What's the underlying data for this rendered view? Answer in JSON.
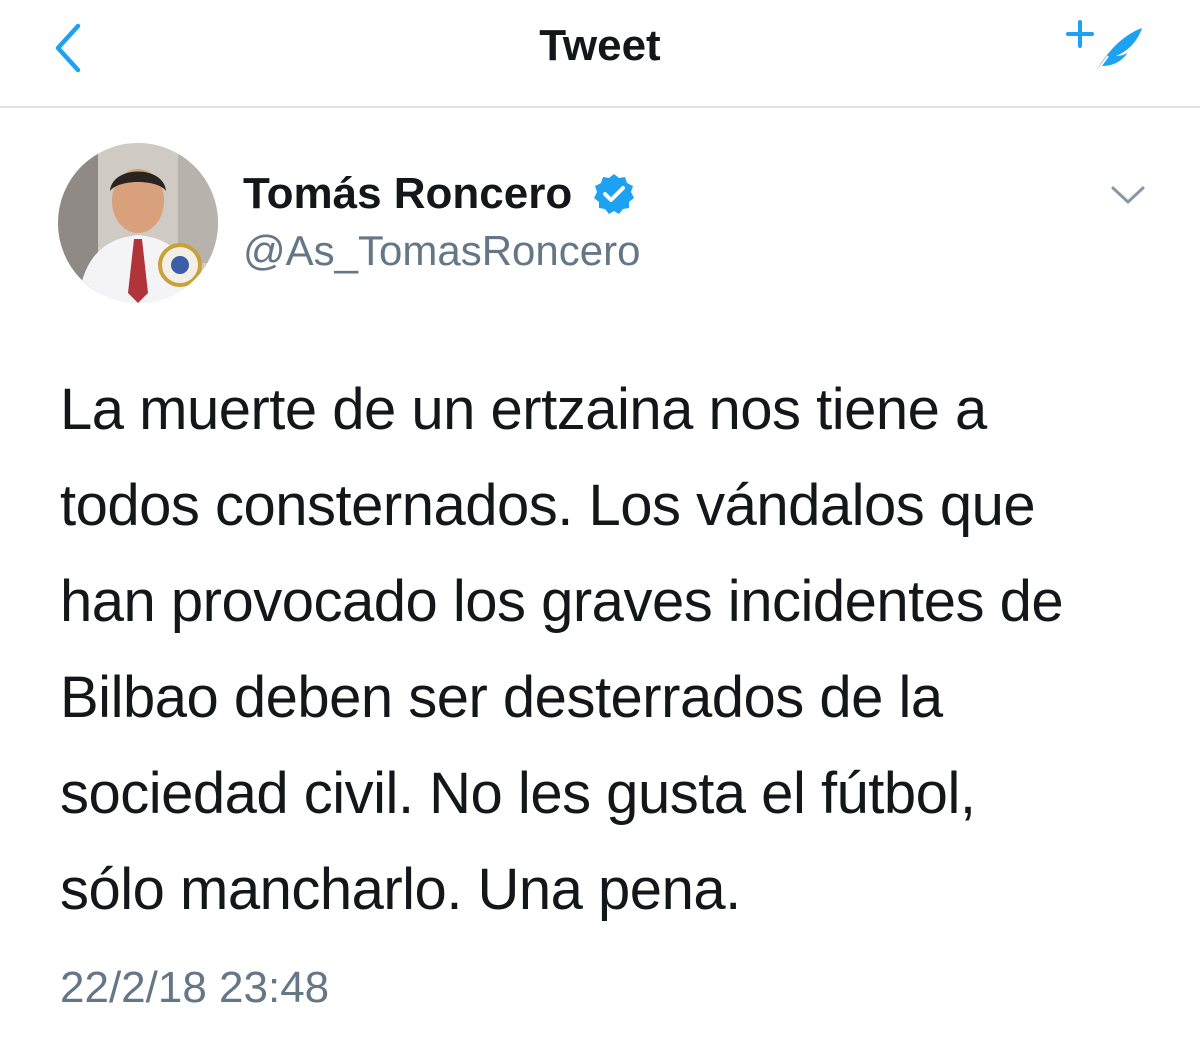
{
  "header": {
    "title": "Tweet",
    "back_icon": "chevron-left-icon",
    "compose_icon": "compose-tweet-icon"
  },
  "tweet": {
    "author": {
      "name": "Tomás Roncero",
      "handle": "@As_TomasRoncero",
      "verified": true,
      "avatar_icon": "avatar"
    },
    "lines": [
      "La muerte de un ertzaina nos tiene a",
      "todos consternados. Los vándalos que",
      "han provocado los graves incidentes de",
      "Bilbao deben ser desterrados de la",
      "sociedad civil. No les gusta el fútbol,",
      "sólo mancharlo. Una pena."
    ],
    "timestamp": "22/2/18 23:48",
    "more_icon": "chevron-down-icon"
  },
  "colors": {
    "accent": "#1da1f2",
    "text": "#14171a",
    "secondary": "#657786",
    "divider": "#dfe2e5"
  }
}
